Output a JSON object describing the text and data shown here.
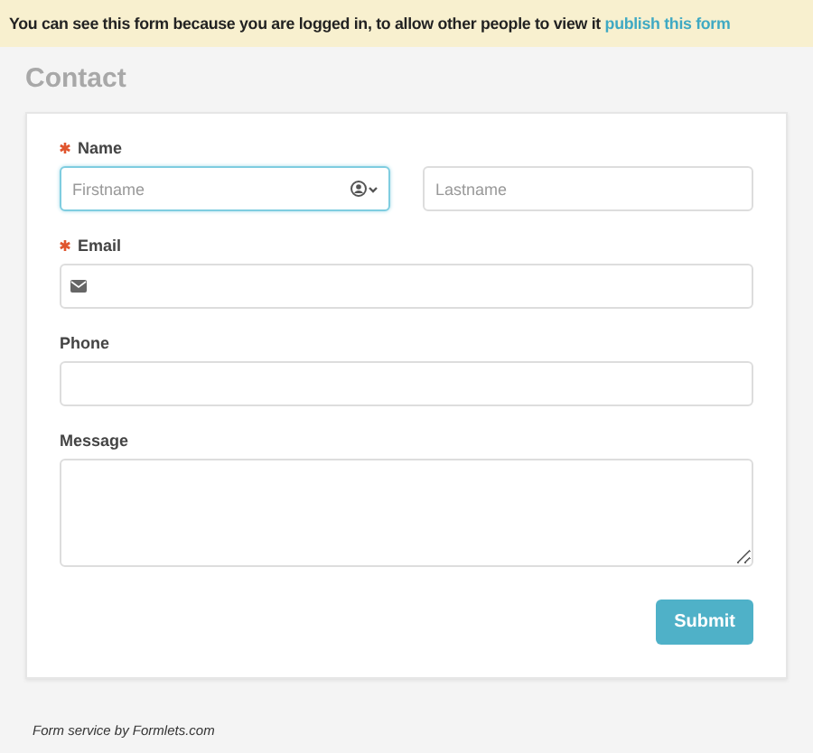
{
  "banner": {
    "text": "You can see this form because you are logged in, to allow other people to view it",
    "link": "publish this form"
  },
  "form": {
    "title": "Contact",
    "fields": [
      {
        "kind": "name",
        "label": "Name",
        "required": true,
        "inputs": [
          {
            "placeholder": "Firstname",
            "focused": true
          },
          {
            "placeholder": "Lastname",
            "focused": false
          }
        ]
      },
      {
        "kind": "email",
        "label": "Email",
        "required": true,
        "inputs": [
          {
            "focused": false
          }
        ]
      },
      {
        "kind": "text",
        "label": "Phone",
        "required": false,
        "inputs": [
          {
            "focused": false
          }
        ]
      },
      {
        "kind": "textarea",
        "label": "Message",
        "required": false,
        "inputs": [
          {
            "focused": false
          }
        ]
      }
    ],
    "submit": "Submit"
  },
  "footer": "Form service by Formlets.com"
}
